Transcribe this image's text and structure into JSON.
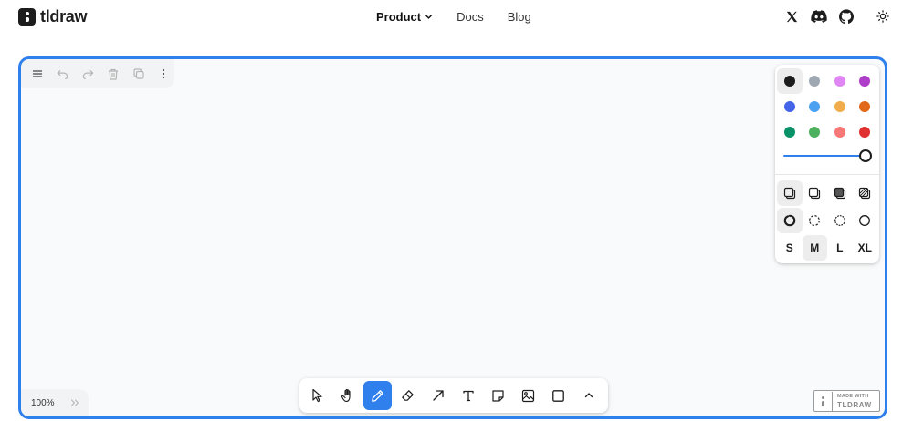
{
  "header": {
    "logo_text": "tldraw",
    "nav": {
      "product": "Product",
      "docs": "Docs",
      "blog": "Blog"
    },
    "social_icons": [
      "x-icon",
      "discord-icon",
      "github-icon"
    ],
    "theme_icon": "sun-icon"
  },
  "menu_panel": {
    "buttons": [
      "menu-icon",
      "undo-icon",
      "redo-icon",
      "trash-icon",
      "duplicate-icon",
      "more-icon"
    ]
  },
  "style_panel": {
    "colors": [
      {
        "name": "black",
        "hex": "#1d1d1d",
        "selected": true
      },
      {
        "name": "grey",
        "hex": "#9fa8b2"
      },
      {
        "name": "light-violet",
        "hex": "#e085f4"
      },
      {
        "name": "violet",
        "hex": "#ae3ec9"
      },
      {
        "name": "blue",
        "hex": "#4465e9"
      },
      {
        "name": "light-blue",
        "hex": "#4ba1f1"
      },
      {
        "name": "yellow",
        "hex": "#f1ac4b"
      },
      {
        "name": "orange",
        "hex": "#e16919"
      },
      {
        "name": "green",
        "hex": "#099268"
      },
      {
        "name": "light-green",
        "hex": "#4cb05e"
      },
      {
        "name": "light-red",
        "hex": "#f87777"
      },
      {
        "name": "red",
        "hex": "#e03131"
      }
    ],
    "opacity": 1.0,
    "fill_options": [
      "fill-none-icon",
      "fill-semi-icon",
      "fill-solid-icon",
      "fill-pattern-icon"
    ],
    "fill_selected": 0,
    "dash_options": [
      "dash-draw-icon",
      "dash-dashed-icon",
      "dash-dotted-icon",
      "dash-solid-icon"
    ],
    "dash_selected": 0,
    "sizes": [
      "S",
      "M",
      "L",
      "XL"
    ],
    "size_selected": 1
  },
  "toolbar": {
    "tools": [
      "select-icon",
      "hand-icon",
      "draw-icon",
      "eraser-icon",
      "arrow-icon",
      "text-icon",
      "note-icon",
      "image-icon",
      "rectangle-icon",
      "more-tools-icon"
    ],
    "active_tool": 2,
    "accent": "#2f80ed"
  },
  "zoom": {
    "label": "100%"
  },
  "watermark": {
    "line1": "MADE WITH",
    "line2": "TLDRAW"
  }
}
